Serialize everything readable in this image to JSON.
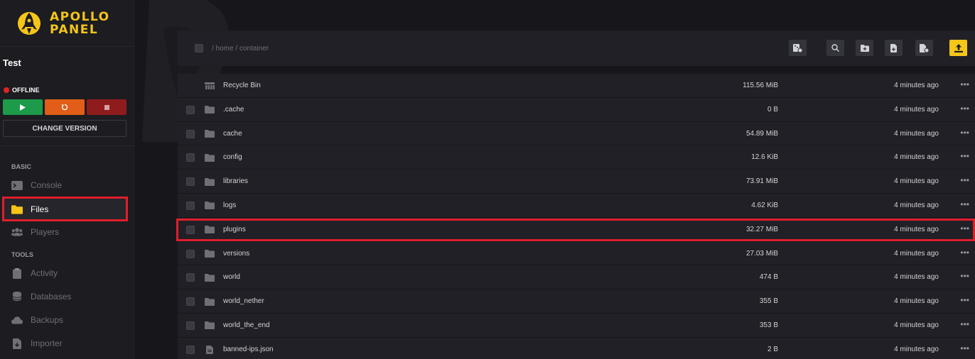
{
  "brand": {
    "name_line1": "APOLLO",
    "name_line2": "PANEL",
    "accent": "#f5c518"
  },
  "server": {
    "name": "Test",
    "status": "OFFLINE",
    "status_color": "#e02424",
    "change_version_label": "CHANGE VERSION"
  },
  "nav": {
    "basic_label": "BASIC",
    "tools_label": "TOOLS",
    "items": [
      {
        "label": "Console",
        "icon": "terminal-icon"
      },
      {
        "label": "Files",
        "icon": "folder-icon"
      },
      {
        "label": "Players",
        "icon": "users-icon"
      },
      {
        "label": "Activity",
        "icon": "clipboard-icon"
      },
      {
        "label": "Databases",
        "icon": "database-icon"
      },
      {
        "label": "Backups",
        "icon": "cloud-icon"
      },
      {
        "label": "Importer",
        "icon": "file-import-icon"
      }
    ]
  },
  "toolbar": {
    "breadcrumb": "/ home / container",
    "buttons": [
      "archive-icon",
      "search-icon",
      "new-folder-icon",
      "new-file-icon",
      "pull-file-icon",
      "upload-icon"
    ]
  },
  "files": [
    {
      "name": "Recycle Bin",
      "size": "115.56 MiB",
      "modified": "4 minutes ago",
      "type": "recycle"
    },
    {
      "name": ".cache",
      "size": "0 B",
      "modified": "4 minutes ago",
      "type": "folder"
    },
    {
      "name": "cache",
      "size": "54.89 MiB",
      "modified": "4 minutes ago",
      "type": "folder"
    },
    {
      "name": "config",
      "size": "12.6 KiB",
      "modified": "4 minutes ago",
      "type": "folder"
    },
    {
      "name": "libraries",
      "size": "73.91 MiB",
      "modified": "4 minutes ago",
      "type": "folder"
    },
    {
      "name": "logs",
      "size": "4.62 KiB",
      "modified": "4 minutes ago",
      "type": "folder"
    },
    {
      "name": "plugins",
      "size": "32.27 MiB",
      "modified": "4 minutes ago",
      "type": "folder"
    },
    {
      "name": "versions",
      "size": "27.03 MiB",
      "modified": "4 minutes ago",
      "type": "folder"
    },
    {
      "name": "world",
      "size": "474 B",
      "modified": "4 minutes ago",
      "type": "folder"
    },
    {
      "name": "world_nether",
      "size": "355 B",
      "modified": "4 minutes ago",
      "type": "folder"
    },
    {
      "name": "world_the_end",
      "size": "353 B",
      "modified": "4 minutes ago",
      "type": "folder"
    },
    {
      "name": "banned-ips.json",
      "size": "2 B",
      "modified": "4 minutes ago",
      "type": "file"
    }
  ],
  "more_glyph": "•••"
}
